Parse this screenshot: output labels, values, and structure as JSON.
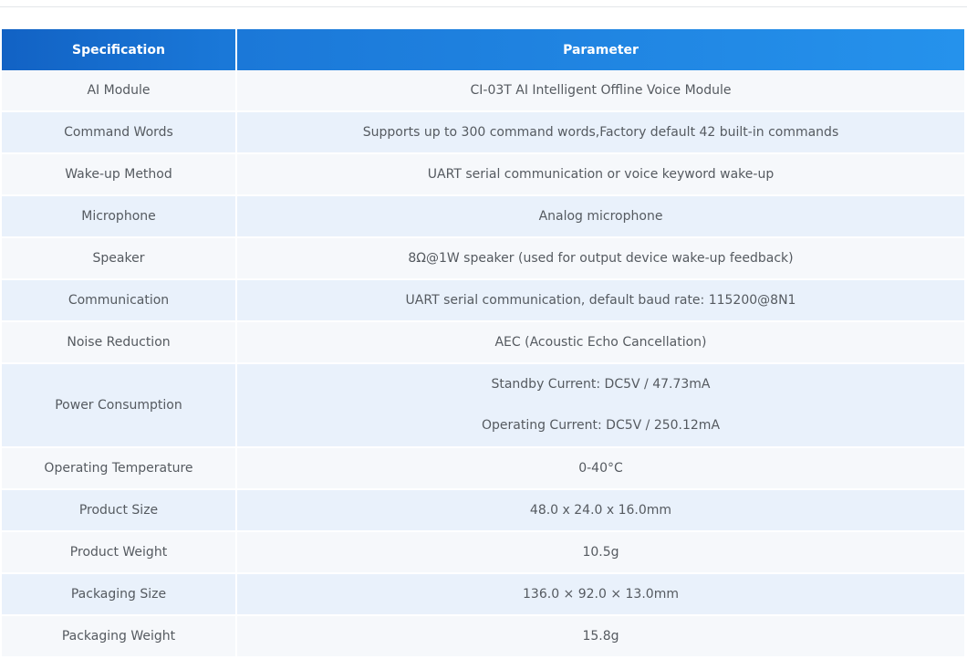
{
  "table": {
    "headers": {
      "specification": "Specification",
      "parameter": "Parameter"
    },
    "rows": [
      {
        "spec": "AI Module",
        "value": [
          "CI-03T AI Intelligent Offline Voice Module"
        ]
      },
      {
        "spec": "Command Words",
        "value": [
          "Supports up to 300 command words,Factory default 42 built-in commands"
        ]
      },
      {
        "spec": "Wake-up Method",
        "value": [
          "UART serial communication or voice keyword wake-up"
        ]
      },
      {
        "spec": "Microphone",
        "value": [
          "Analog microphone"
        ]
      },
      {
        "spec": "Speaker",
        "value": [
          "8Ω@1W speaker (used for output device wake-up feedback)"
        ]
      },
      {
        "spec": "Communication",
        "value": [
          "UART serial communication, default baud rate: 115200@8N1"
        ]
      },
      {
        "spec": "Noise Reduction",
        "value": [
          "AEC (Acoustic Echo Cancellation)"
        ]
      },
      {
        "spec": "Power Consumption",
        "value": [
          "Standby Current: DC5V / 47.73mA",
          "Operating Current: DC5V / 250.12mA"
        ]
      },
      {
        "spec": "Operating Temperature",
        "value": [
          "0-40°C"
        ]
      },
      {
        "spec": "Product Size",
        "value": [
          "48.0 x 24.0 x 16.0mm"
        ]
      },
      {
        "spec": "Product Weight",
        "value": [
          "10.5g"
        ]
      },
      {
        "spec": "Packaging Size",
        "value": [
          "136.0 × 92.0 × 13.0mm"
        ]
      },
      {
        "spec": "Packaging Weight",
        "value": [
          "15.8g"
        ]
      }
    ]
  }
}
